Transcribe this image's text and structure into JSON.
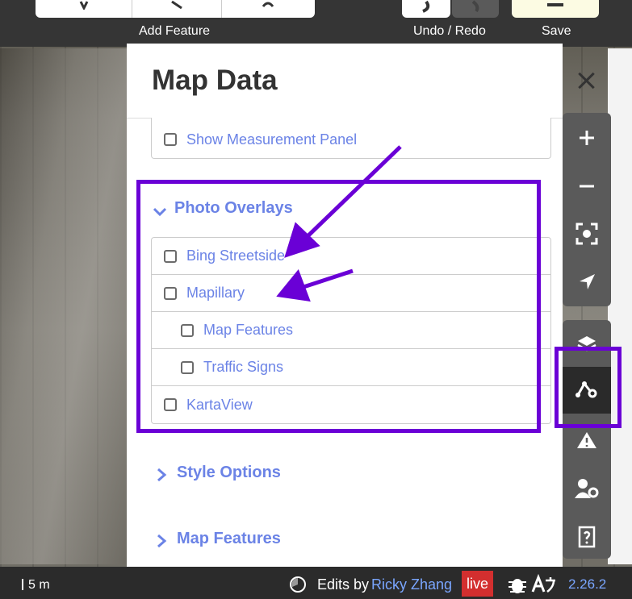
{
  "toolbar": {
    "add_feature_label": "Add Feature",
    "undo_redo_label": "Undo / Redo",
    "save_label": "Save"
  },
  "panel": {
    "title": "Map Data",
    "measurement_panel_label": "Show Measurement Panel",
    "photo_overlays_heading": "Photo Overlays",
    "photo_overlays": {
      "bing": "Bing Streetside",
      "mapillary": "Mapillary",
      "mapillary_features": "Map Features",
      "mapillary_signs": "Traffic Signs",
      "kartaview": "KartaView"
    },
    "style_options_heading": "Style Options",
    "map_features_heading": "Map Features"
  },
  "footer": {
    "scale": "5 m",
    "edits_by": "Edits by",
    "user": "Ricky Zhang",
    "live": "live",
    "version": "2.26.2"
  },
  "colors": {
    "accent": "#6b83e6",
    "annotation": "#6a00d6",
    "live_badge": "#d32f2f"
  }
}
